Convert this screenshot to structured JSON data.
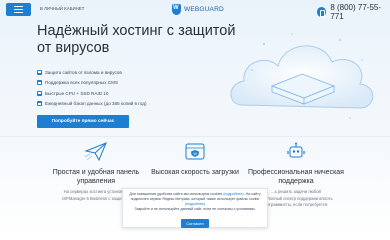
{
  "header": {
    "client_link": "В ЛИЧНЫЙ КАБИНЕТ",
    "brand": "WEBGUARD",
    "phone": "8 (800) 77-55-771"
  },
  "hero": {
    "title": "Надёжный хостинг с защитой от вирусов",
    "features": [
      "Защита сайтов от взлома и вирусов",
      "Поддержка всех популярных CMS",
      "Быстрые CPU + SSD RAID 10",
      "Ежедневный бэкап данных (до 365 копий в год)"
    ],
    "cta": "Попробуйте прямо сейчас"
  },
  "cards": [
    {
      "title": "Простая и удобная панель управления",
      "lines": [
        "На серверах хостинга установл...",
        "ISPManager 6 Business с защиты..."
      ]
    },
    {
      "title": "Высокая скорость загрузки",
      "lines": []
    },
    {
      "title": "Профессиональная ническая поддержка",
      "lines": [
        "...ь решить задачи любой",
        "...т. Полный спектр поддержки вплоть",
        "...ограммисты, если потребуется."
      ]
    }
  ],
  "cookie": {
    "text1": "Для повышения удобства сайта мы используем cookies",
    "link1": "(подробнее)",
    "text2": ". На сайту подключен сервис Яндекс.Метрика, который также использует файлы cookie",
    "link2": "(подробнее)",
    "text3": "Закройте и не используйте данный сайт, если не согласны с условиями.",
    "button": "Согласен"
  },
  "colors": {
    "accent": "#1d7fd1",
    "text": "#2a2f3a",
    "muted": "#6b7684"
  }
}
